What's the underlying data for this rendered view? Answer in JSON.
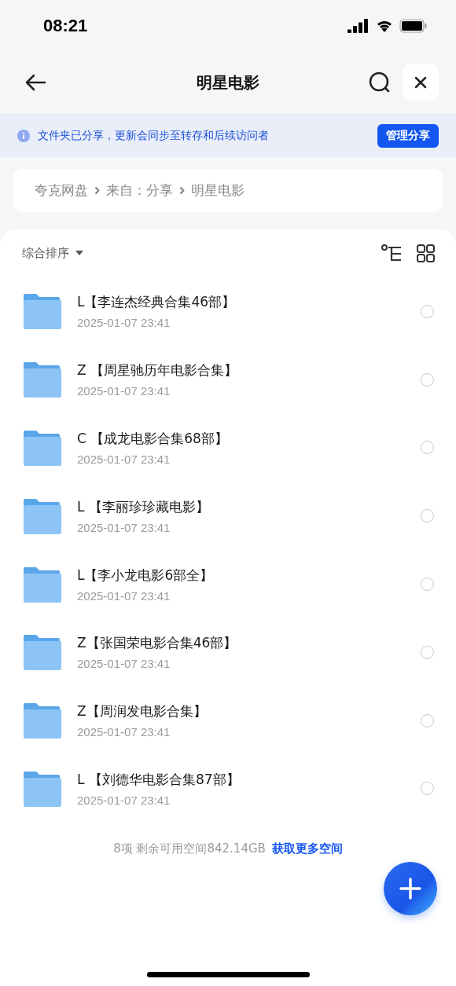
{
  "status_bar": {
    "time": "08:21"
  },
  "nav": {
    "title": "明星电影"
  },
  "banner": {
    "text": "文件夹已分享，更新会同步至转存和后续访问者",
    "button": "管理分享"
  },
  "breadcrumb": [
    "夸克网盘",
    "来自：分享",
    "明星电影"
  ],
  "toolbar": {
    "sort": "综合排序"
  },
  "files": [
    {
      "name": "L【李连杰经典合集46部】",
      "date": "2025-01-07 23:41",
      "selected": false
    },
    {
      "name": "Z 【周星驰历年电影合集】",
      "date": "2025-01-07 23:41",
      "selected": false
    },
    {
      "name": "C 【成龙电影合集68部】",
      "date": "2025-01-07 23:41",
      "selected": false
    },
    {
      "name": "L 【李丽珍珍藏电影】",
      "date": "2025-01-07 23:41",
      "selected": false
    },
    {
      "name": "L【李小龙电影6部全】",
      "date": "2025-01-07 23:41",
      "selected": false
    },
    {
      "name": "Z【张国荣电影合集46部】",
      "date": "2025-01-07 23:41",
      "selected": false
    },
    {
      "name": "Z【周润发电影合集】",
      "date": "2025-01-07 23:41",
      "selected": false
    },
    {
      "name": "L 【刘德华电影合集87部】",
      "date": "2025-01-07 23:41",
      "selected": false
    }
  ],
  "footer": {
    "summary": "8项 剩余可用空间842.14GB",
    "link": "获取更多空间"
  }
}
